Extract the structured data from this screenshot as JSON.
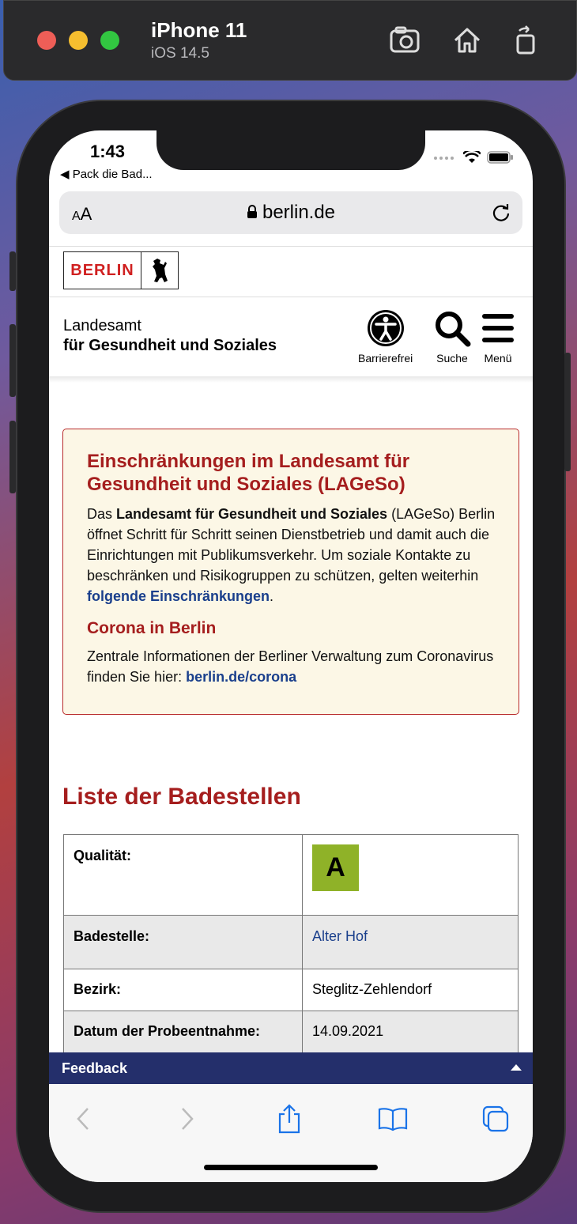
{
  "simulator": {
    "device": "iPhone 11",
    "os": "iOS 14.5"
  },
  "status_bar": {
    "time": "1:43",
    "back_app": "◀ Pack die Bad..."
  },
  "safari": {
    "text_size": "AA",
    "domain": "berlin.de"
  },
  "site": {
    "logo_text": "BERLIN",
    "org_line1": "Landesamt",
    "org_line2": "für Gesundheit und Soziales",
    "nav": {
      "accessibility": "Barrierefrei",
      "search": "Suche",
      "menu": "Menü"
    }
  },
  "notice": {
    "title": "Einschränkungen im Landesamt für Gesundheit und Soziales (LAGeSo)",
    "p1_pre": "Das ",
    "p1_bold": "Landesamt für Gesundheit und Soziales",
    "p1_mid": " (LAGeSo) Berlin öffnet Schritt für Schritt seinen Dienstbetrieb und damit auch die Einrichtungen mit Publikumsverkehr. Um soziale Kontakte zu beschränken und Risikogruppen zu schützen, gelten weiterhin ",
    "p1_link": "folgende Einschränkungen",
    "p1_end": ".",
    "subtitle": "Corona in Berlin",
    "p2_pre": "Zentrale Informationen der Berliner Verwaltung zum Coronavirus finden Sie hier: ",
    "p2_link": "berlin.de/corona"
  },
  "list": {
    "title": "Liste der Badestellen",
    "rows": [
      {
        "label": "Qualität:",
        "grade": "A"
      },
      {
        "label": "Badestelle:",
        "value": "Alter Hof"
      },
      {
        "label": "Bezirk:",
        "value": "Steglitz-Zehlendorf"
      },
      {
        "label": "Datum der Probeentnahme:",
        "value": "14.09.2021"
      }
    ]
  },
  "feedback": {
    "label": "Feedback"
  },
  "colors": {
    "brand_red": "#a51e1e",
    "link_blue": "#1a3f8c",
    "grade_green": "#8fb228",
    "feedback_bg": "#242f6b"
  }
}
